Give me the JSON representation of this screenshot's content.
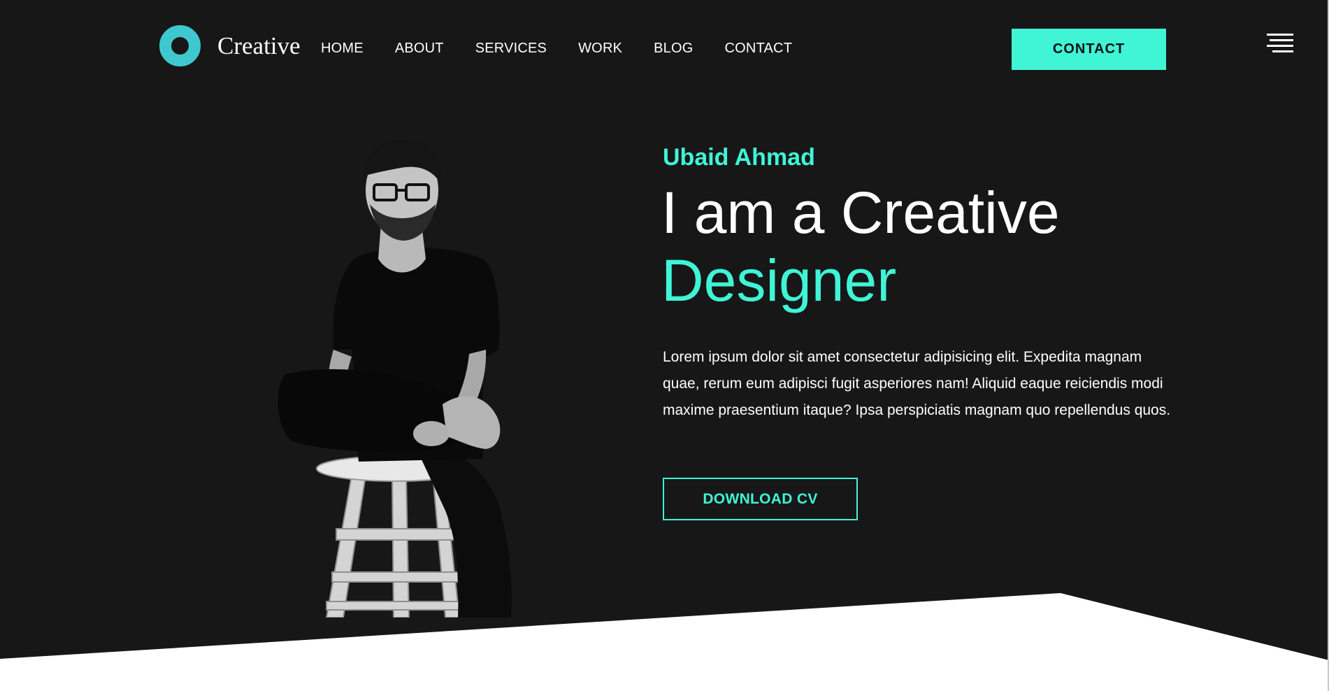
{
  "colors": {
    "background": "#171717",
    "accent": "#3ff5d6",
    "logo_ring": "#3fc7cf",
    "text": "#ffffff",
    "below_fold": "#ffffff"
  },
  "header": {
    "logo_icon": "ring-logo-icon",
    "logo_text": "Creative",
    "nav": [
      {
        "label": "HOME"
      },
      {
        "label": "ABOUT"
      },
      {
        "label": "SERVICES"
      },
      {
        "label": "WORK"
      },
      {
        "label": "BLOG"
      },
      {
        "label": "CONTACT"
      }
    ],
    "contact_button": "CONTACT",
    "menu_icon": "hamburger-menu-icon"
  },
  "hero": {
    "name": "Ubaid Ahmad",
    "headline_line1": "I am a Creative",
    "headline_line2": "Designer",
    "bio": "Lorem ipsum dolor sit amet consectetur adipisicing elit. Expedita magnam quae, rerum eum adipisci fugit asperiores nam! Aliquid eaque reiciendis modi maxime praesentium itaque? Ipsa perspiciatis magnam quo repellendus quos.",
    "download_button": "DOWNLOAD CV",
    "portrait": "man-seated-on-stool-photo"
  }
}
